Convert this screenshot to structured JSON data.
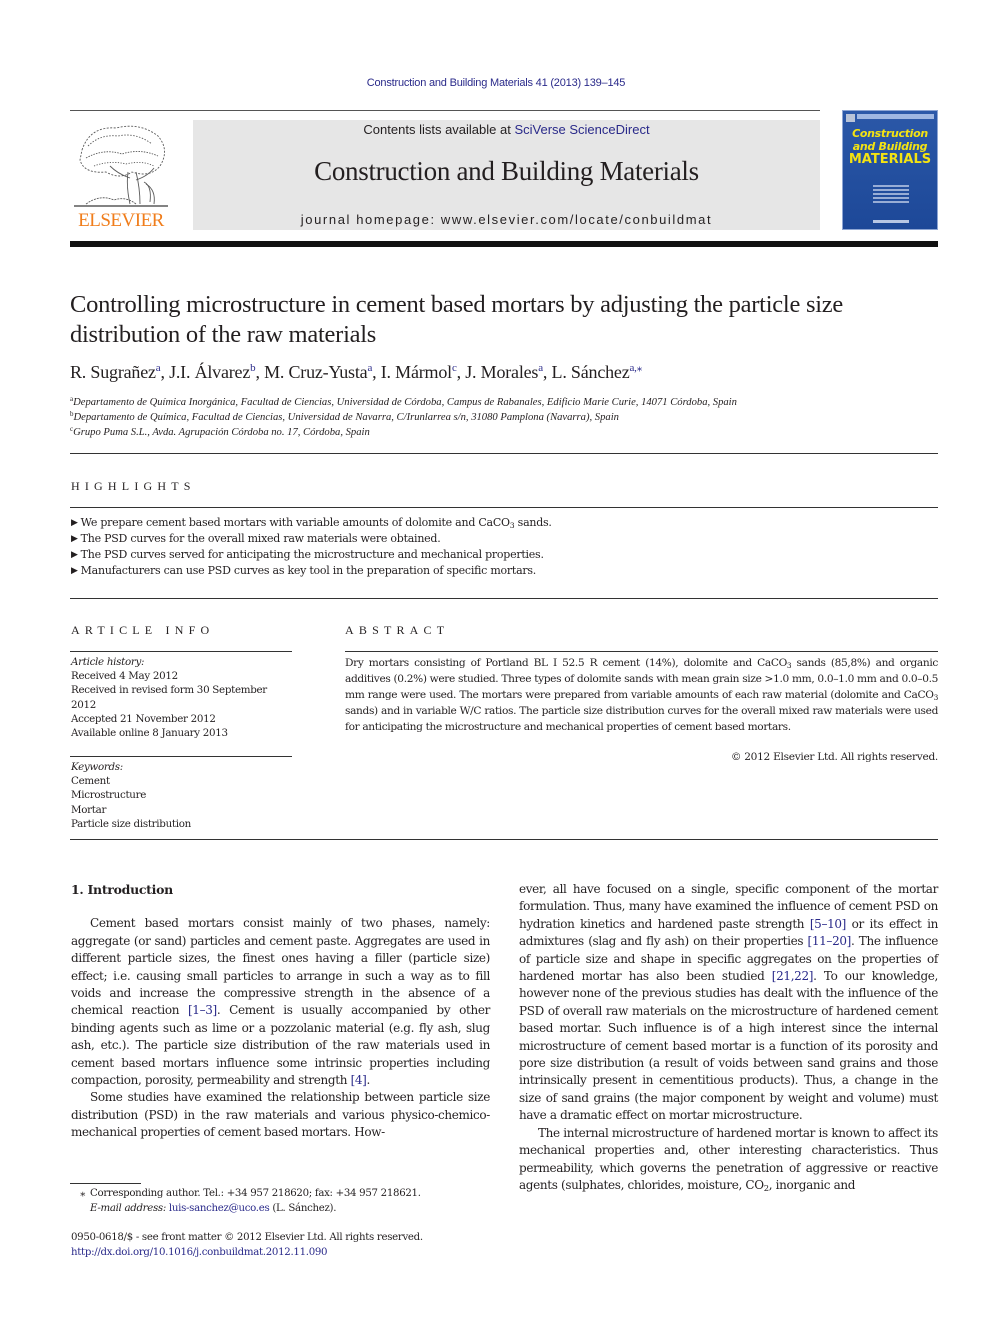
{
  "journal": {
    "running_head": "Construction and Building Materials 41 (2013) 139–145",
    "publisher_logo_text": "ELSEVIER",
    "contents_prefix": "Contents lists available at ",
    "contents_link": "SciVerse ScienceDirect",
    "title": "Construction and Building Materials",
    "homepage_prefix": "journal homepage: ",
    "homepage_url": "www.elsevier.com/locate/conbuildmat",
    "cover": {
      "line1": "Construction",
      "line2": "and Building",
      "line3": "MATERIALS"
    }
  },
  "article": {
    "title": "Controlling microstructure in cement based mortars by adjusting the particle size distribution of the raw materials",
    "authors": [
      {
        "name": "R. Sugrañez",
        "sup": "a",
        "sep": ", "
      },
      {
        "name": "J.I. Álvarez",
        "sup": "b",
        "sep": ", "
      },
      {
        "name": "M. Cruz-Yusta",
        "sup": "a",
        "sep": ", "
      },
      {
        "name": "I. Mármol",
        "sup": "c",
        "sep": ", "
      },
      {
        "name": "J. Morales",
        "sup": "a",
        "sep": ", "
      },
      {
        "name": "L. Sánchez",
        "sup": "a,⁎",
        "sep": ""
      }
    ],
    "affiliations": [
      {
        "sup": "a",
        "text": "Departamento de Química Inorgánica, Facultad de Ciencias, Universidad de Córdoba, Campus de Rabanales, Edificio Marie Curie, 14071 Córdoba, Spain"
      },
      {
        "sup": "b",
        "text": "Departamento de Química, Facultad de Ciencias, Universidad de Navarra, C/Irunlarrea s/n, 31080 Pamplona (Navarra), Spain"
      },
      {
        "sup": "c",
        "text": "Grupo Puma S.L., Avda. Agrupación Córdoba no. 17, Córdoba, Spain"
      }
    ]
  },
  "highlights": {
    "heading": "HIGHLIGHTS",
    "bullet_icon": "▶",
    "items": [
      [
        {
          "t": "We prepare cement based mortars with variable amounts of dolomite and CaCO"
        },
        {
          "sub": "3"
        },
        {
          "t": " sands."
        }
      ],
      [
        {
          "t": "The PSD curves for the overall mixed raw materials were obtained."
        }
      ],
      [
        {
          "t": "The PSD curves served for anticipating the microstructure and mechanical properties."
        }
      ],
      [
        {
          "t": "Manufacturers can use PSD curves as key tool in the preparation of specific mortars."
        }
      ]
    ]
  },
  "article_info": {
    "heading": "ARTICLE INFO",
    "history_label": "Article history:",
    "history": [
      "Received 4 May 2012",
      "Received in revised form 30 September 2012",
      "Accepted 21 November 2012",
      "Available online 8 January 2013"
    ],
    "keywords_label": "Keywords:",
    "keywords": [
      "Cement",
      "Microstructure",
      "Mortar",
      "Particle size distribution"
    ]
  },
  "abstract": {
    "heading": "ABSTRACT",
    "body": [
      {
        "t": "Dry mortars consisting of Portland BL I 52.5 R cement (14%), dolomite and CaCO"
      },
      {
        "sub": "3"
      },
      {
        "t": " sands (85,8%) and organic additives (0.2%) were studied. Three types of dolomite sands with mean grain size >1.0 mm, 0.0–1.0 mm and 0.0–0.5 mm range were used. The mortars were prepared from variable amounts of each raw material (dolomite and CaCO"
      },
      {
        "sub": "3"
      },
      {
        "t": " sands) and in variable W/C ratios. The particle size distribution curves for the overall mixed raw materials were used for anticipating the microstructure and mechanical properties of cement based mortars."
      }
    ],
    "copyright": "© 2012 Elsevier Ltd. All rights reserved."
  },
  "body": {
    "section_title": "1. Introduction",
    "paragraphs": [
      [
        {
          "t": "Cement based mortars consist mainly of two phases, namely: aggregate (or sand) particles and cement paste. Aggregates are used in different particle sizes, the finest ones having a filler (particle size) effect; i.e. causing small particles to arrange in such a way as to fill voids and increase the compressive strength in the absence of a chemical reaction "
        },
        {
          "link": "[1–3]"
        },
        {
          "t": ". Cement is usually accompanied by other binding agents such as lime or a pozzolanic material (e.g. fly ash, slug ash, etc.). The particle size distribution of the raw materials used in cement based mortars influence some intrinsic properties including compaction, porosity, permeability and strength "
        },
        {
          "link": "[4]"
        },
        {
          "t": "."
        }
      ],
      [
        {
          "t": "Some studies have examined the relationship between particle size distribution (PSD) in the raw materials and various physico-chemico-mechanical properties of cement based mortars. However, all have focused on a single, specific component of the mortar formulation. Thus, many have examined the influence of cement PSD on hydration kinetics and hardened paste strength "
        },
        {
          "link": "[5–10]"
        },
        {
          "t": " or its effect in admixtures (slag and fly ash) on their properties "
        },
        {
          "link": "[11–20]"
        },
        {
          "t": ". The influence of particle size and shape in specific aggregates on the properties of hardened mortar has also been studied "
        },
        {
          "link": "[21,22]"
        },
        {
          "t": ". To our knowledge, however none of the previous studies has dealt with the influence of the PSD of overall raw materials on the microstructure of hardened cement based mortar. Such influence is of a high interest since the internal microstructure of cement based mortar is a function of its porosity and pore size distribution (a result of voids between sand grains and those intrinsically present in cementitious products). Thus, a change in the size of sand grains (the major component by weight and volume) must have a dramatic effect on mortar microstructure."
        }
      ],
      [
        {
          "t": "The internal microstructure of hardened mortar is known to affect its mechanical properties and, other interesting characteristics. Thus permeability, which governs the penetration of aggressive or reactive agents (sulphates, chlorides, moisture, CO"
        },
        {
          "sub": "2"
        },
        {
          "t": ", inorganic and"
        }
      ]
    ],
    "left_col_text_1": "Cement based mortars consist mainly of two phases, namely: aggregate (or sand) particles and cement paste. Aggregates are used in different particle sizes, the finest ones having a filler (particle size) effect; i.e. causing small particles to arrange in such a way as to fill voids and increase the compressive strength in the absence of a chemical reaction "
  },
  "footnote": {
    "star": "⁎",
    "corresponding": "Corresponding author. Tel.: +34 957 218620; fax: +34 957 218621.",
    "email_label": "E-mail address:",
    "email": "luis-sanchez@uco.es",
    "email_suffix": " (L. Sánchez)."
  },
  "issn": {
    "line": "0950-0618/$ - see front matter © 2012 Elsevier Ltd. All rights reserved.",
    "doi": "http://dx.doi.org/10.1016/j.conbuildmat.2012.11.090"
  }
}
